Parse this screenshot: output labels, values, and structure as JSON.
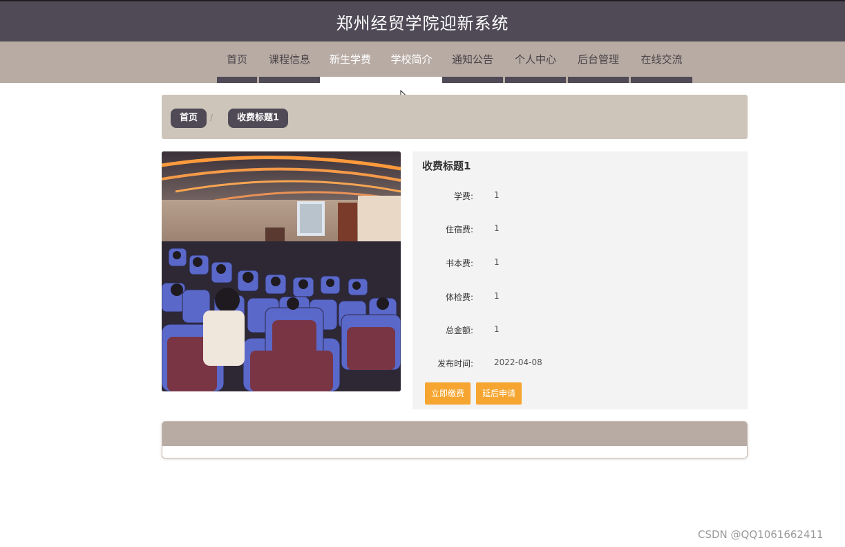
{
  "header": {
    "title": "郑州经贸学院迎新系统"
  },
  "nav": {
    "items": [
      {
        "label": "首页",
        "active": false
      },
      {
        "label": "课程信息",
        "active": false
      },
      {
        "label": "新生学费",
        "active": true
      },
      {
        "label": "学校简介",
        "active": true
      },
      {
        "label": "通知公告",
        "active": false
      },
      {
        "label": "个人中心",
        "active": false
      },
      {
        "label": "后台管理",
        "active": false
      },
      {
        "label": "在线交流",
        "active": false
      }
    ]
  },
  "breadcrumb": {
    "home": "首页",
    "separator": "/",
    "current": "收费标题1"
  },
  "detail": {
    "title": "收费标题1",
    "fields": [
      {
        "label": "学费:",
        "value": "1"
      },
      {
        "label": "住宿费:",
        "value": "1"
      },
      {
        "label": "书本费:",
        "value": "1"
      },
      {
        "label": "体检费:",
        "value": "1"
      },
      {
        "label": "总金额:",
        "value": "1"
      },
      {
        "label": "发布时间:",
        "value": "2022-04-08"
      }
    ],
    "pay_button": "立即缴费",
    "defer_button": "延后申请"
  },
  "watermark": "CSDN @QQ1061662411",
  "colors": {
    "header_bg": "#4f4a56",
    "nav_bg": "#b8aba4",
    "breadcrumb_bg": "#cdc4ba",
    "button_accent": "#f5a530"
  }
}
